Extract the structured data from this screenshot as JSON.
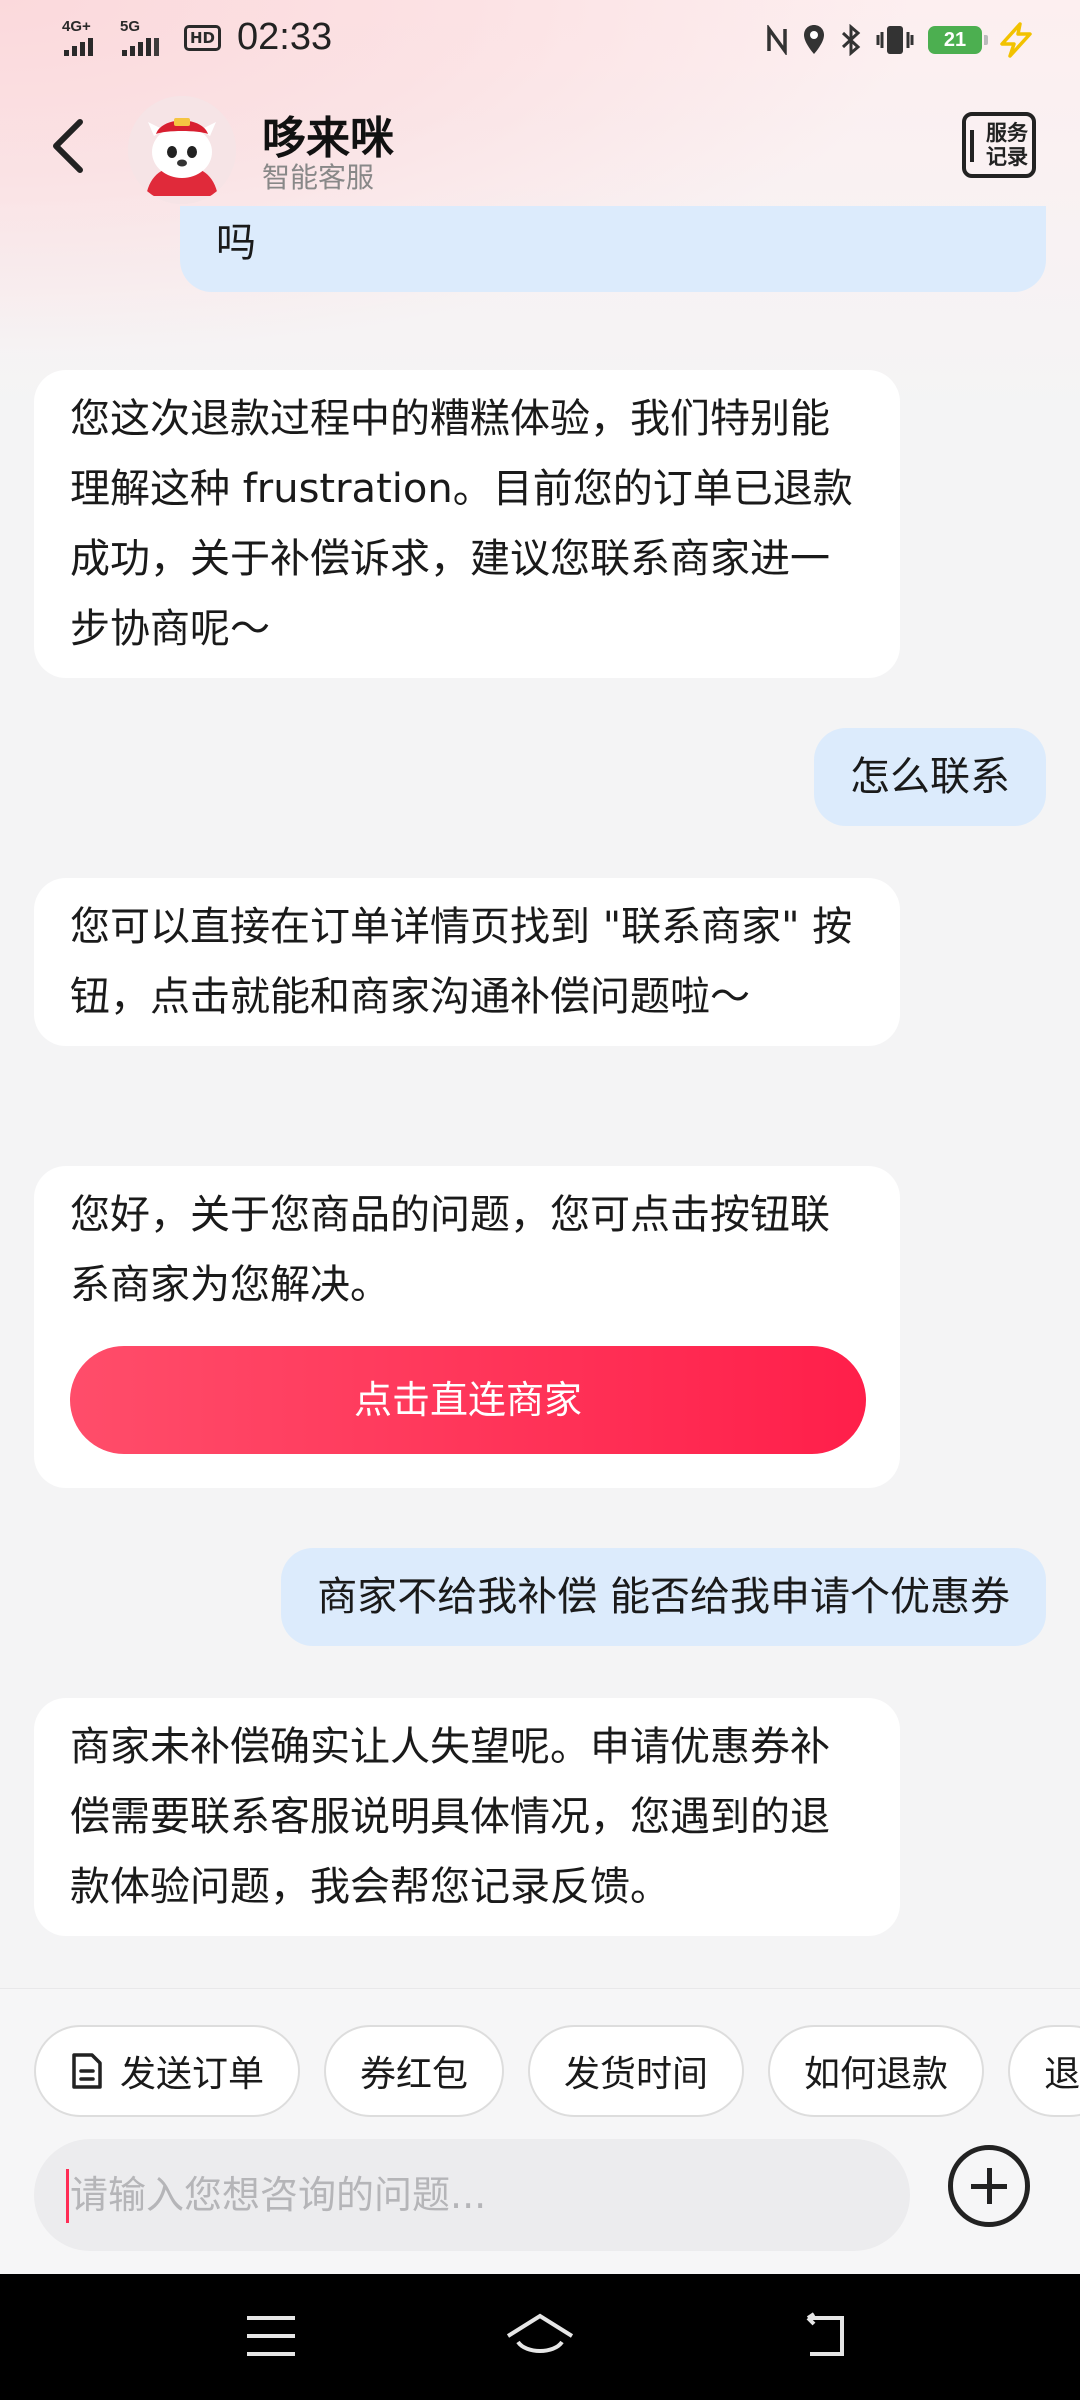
{
  "status_bar": {
    "network_1": "4G+",
    "network_2": "5G",
    "hd": "HD",
    "time": "02:33",
    "battery": "21",
    "icons": [
      "nfc-icon",
      "location-icon",
      "bluetooth-icon",
      "vibrate-icon",
      "battery-icon",
      "charging-icon"
    ]
  },
  "header": {
    "title": "哆来咪",
    "subtitle": "智能客服",
    "service_record_line1": "服务",
    "service_record_line2": "记录"
  },
  "messages": [
    {
      "role": "user",
      "text": "退款速度体验感极差，可以给我申请个补偿吗"
    },
    {
      "role": "bot",
      "text": "您这次退款过程中的糟糕体验，我们特别能理解这种 frustration。目前您的订单已退款成功，关于补偿诉求，建议您联系商家进一步协商呢～"
    },
    {
      "role": "user",
      "text": "怎么联系"
    },
    {
      "role": "bot",
      "text": "您可以直接在订单详情页找到 \"联系商家\" 按钮，点击就能和商家沟通补偿问题啦～"
    },
    {
      "role": "bot",
      "text": "您好，关于您商品的问题，您可点击按钮联系商家为您解决。",
      "button": "点击直连商家"
    },
    {
      "role": "user",
      "text": "商家不给我补偿 能否给我申请个优惠券"
    },
    {
      "role": "bot",
      "text": "商家未补偿确实让人失望呢。申请优惠券补偿需要联系客服说明具体情况，您遇到的退款体验问题，我会帮您记录反馈。"
    }
  ],
  "quick_replies": [
    "发送订单",
    "券红包",
    "发货时间",
    "如何退款",
    "退"
  ],
  "input": {
    "placeholder": "请输入您想咨询的问题...",
    "value": ""
  },
  "colors": {
    "accent": "#ff2d55",
    "user_bubble": "#dcebfc",
    "bot_bubble": "#ffffff"
  }
}
